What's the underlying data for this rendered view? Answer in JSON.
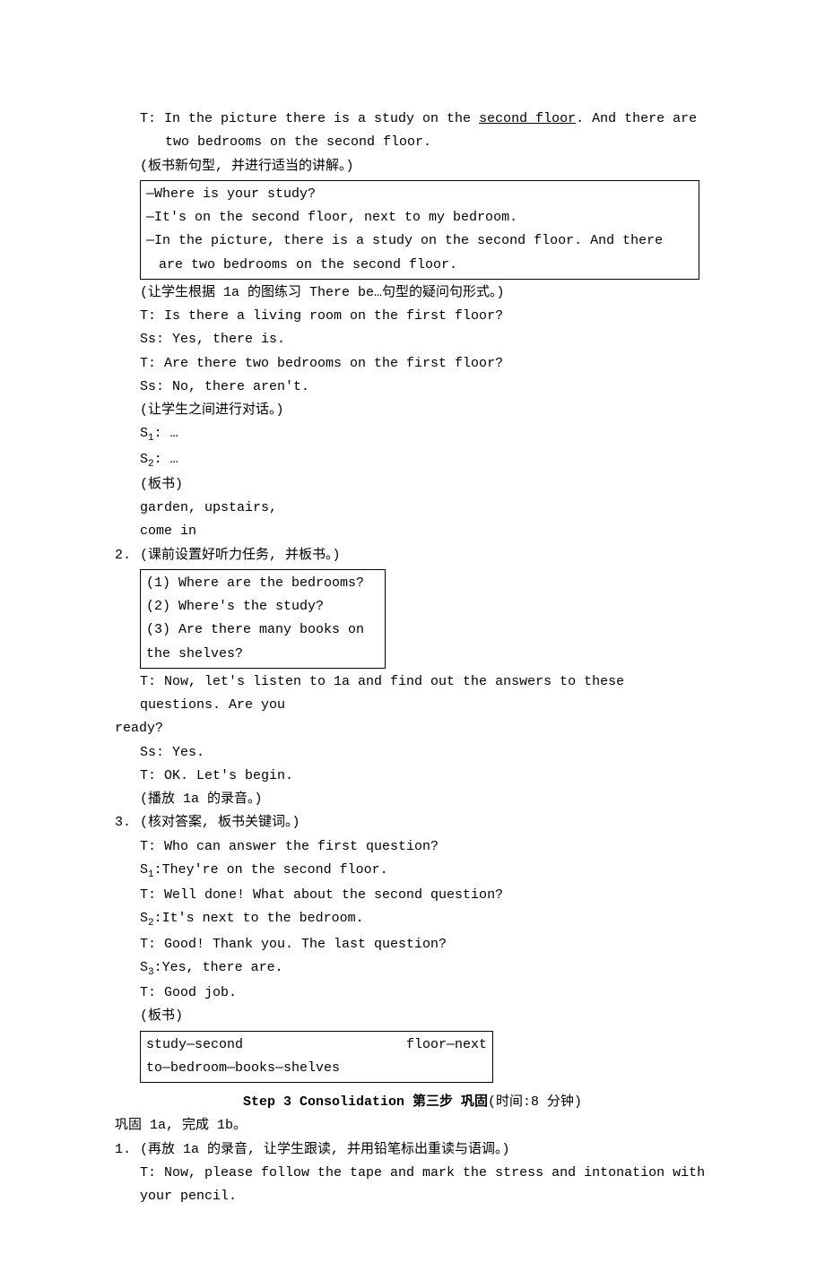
{
  "l1a": "T: In the picture there is a study on the ",
  "l1u": "second floor",
  "l1b": ". And there are two bedrooms on the second floor.",
  "l2": "(板书新句型, 并进行适当的讲解。)",
  "box1": {
    "a": "—Where is your study?",
    "b": "—It's on the second floor, next to my bedroom.",
    "c": "—In the picture, there is a study on the second floor. And there are two bedrooms on the second floor."
  },
  "l3": "(让学生根据 1a 的图练习 There be…句型的疑问句形式。)",
  "l4": "T: Is there a living room on the first floor?",
  "l5": "Ss:   Yes, there is.",
  "l6": "T: Are there two bedrooms on the first floor?",
  "l7": "Ss:   No, there aren't.",
  "l8": "(让学生之间进行对话。)",
  "l9a": "S",
  "l9b": ": …",
  "l10a": "S",
  "l10b": ": …",
  "l11": "(板书)",
  "l12": " garden,    upstairs,",
  "l13": " come in",
  "item2": {
    "num": "2.",
    "text": " (课前设置好听力任务, 并板书。)"
  },
  "box2": {
    "a": "(1) Where are the bedrooms?",
    "b": "(2) Where's the study?",
    "c": "(3) Are there many books on the shelves?"
  },
  "l14": "T: Now, let's listen to 1a and find out the answers to these questions. Are you ready?",
  "l14b": "ready?",
  "l15": "Ss:   Yes.",
  "l16": "T: OK. Let's begin.",
  "l17": "(播放 1a 的录音。)",
  "item3": {
    "num": "3.",
    "text": " (核对答案, 板书关键词。)"
  },
  "l18": "T: Who can answer the first question?",
  "l19a": "S",
  "l19b": ":They're on the second floor.",
  "l20": "T: Well done! What about the second question?",
  "l21a": "S",
  "l21b": ":It's next to the bedroom.",
  "l22": "T: Good! Thank you. The last question?",
  "l23a": "S",
  "l23b": ":Yes, there are.",
  "l24": "T: Good job.",
  "l25": "(板书)",
  "box3": {
    "a": "study—second",
    "b": "floor—next",
    "c": "to—bedroom—books—shelves"
  },
  "step3": {
    "bold": "Step 3  Consolidation 第三步  巩固",
    "rest": "(时间:8 分钟)"
  },
  "l26": "巩固 1a, 完成 1b。",
  "item1b": {
    "num": "1.",
    "text": " (再放 1a 的录音, 让学生跟读, 并用铅笔标出重读与语调。)"
  },
  "l27": "T: Now, please follow the tape and mark the stress and intonation with your pencil."
}
